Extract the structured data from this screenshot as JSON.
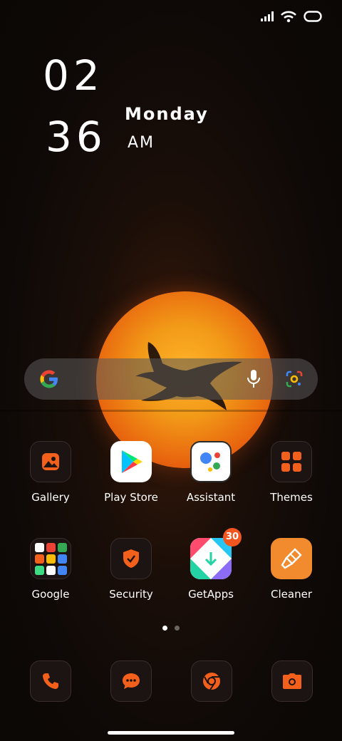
{
  "clock": {
    "hour": "02",
    "minute": "36",
    "day": "Monday",
    "ampm": "AM"
  },
  "status_icons": [
    "signal-icon",
    "wifi-icon",
    "battery-icon"
  ],
  "search": {
    "left_icon": "google-g-icon",
    "right_icons": [
      "mic-icon",
      "lens-icon"
    ]
  },
  "apps_row1": [
    {
      "label": "Gallery",
      "icon": "gallery-icon"
    },
    {
      "label": "Play Store",
      "icon": "play-store-icon"
    },
    {
      "label": "Assistant",
      "icon": "assistant-icon"
    },
    {
      "label": "Themes",
      "icon": "themes-icon"
    }
  ],
  "apps_row2": [
    {
      "label": "Google",
      "icon": "google-folder-icon"
    },
    {
      "label": "Security",
      "icon": "security-icon"
    },
    {
      "label": "GetApps",
      "icon": "getapps-icon",
      "badge": "30"
    },
    {
      "label": "Cleaner",
      "icon": "cleaner-icon"
    }
  ],
  "page_indicator": {
    "pages": 2,
    "current": 1
  },
  "dock": [
    {
      "icon": "phone-icon"
    },
    {
      "icon": "messages-icon"
    },
    {
      "icon": "chrome-icon"
    },
    {
      "icon": "camera-icon"
    }
  ],
  "colors": {
    "accent": "#f2601c",
    "badge": "#f2561f",
    "sun": "#f29a18"
  }
}
